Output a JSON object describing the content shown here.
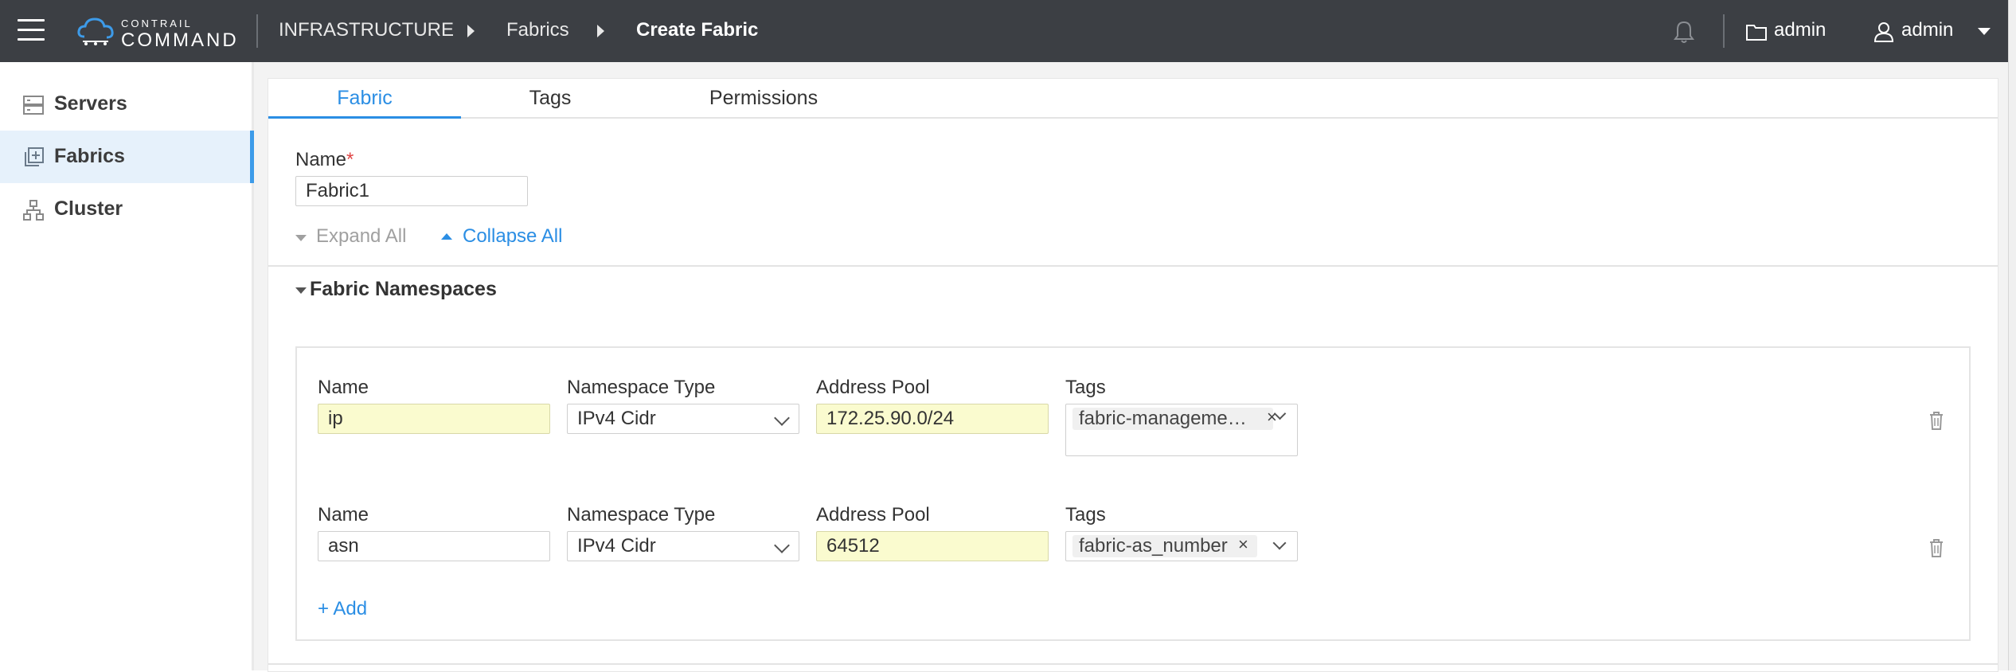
{
  "header": {
    "logo_small": "CONTRAIL",
    "logo_big": "COMMAND",
    "breadcrumb": [
      "INFRASTRUCTURE",
      "Fabrics",
      "Create Fabric"
    ],
    "project_label": "admin",
    "user_label": "admin",
    "icons": [
      "menu-icon",
      "cloud-logo-icon",
      "bell-icon",
      "folder-icon",
      "user-icon",
      "chevron-down-icon"
    ]
  },
  "sidebar": {
    "items": [
      {
        "label": "Servers",
        "icon": "server-icon",
        "active": false
      },
      {
        "label": "Fabrics",
        "icon": "fabric-icon",
        "active": true
      },
      {
        "label": "Cluster",
        "icon": "cluster-icon",
        "active": false
      }
    ]
  },
  "tabs": [
    {
      "label": "Fabric",
      "active": true
    },
    {
      "label": "Tags",
      "active": false
    },
    {
      "label": "Permissions",
      "active": false
    }
  ],
  "form": {
    "name_label": "Name",
    "required_mark": "*",
    "name_value": "Fabric1",
    "expand_all": "Expand All",
    "collapse_all": "Collapse All",
    "section_title": "Fabric Namespaces",
    "col_labels": {
      "name": "Name",
      "type": "Namespace Type",
      "pool": "Address Pool",
      "tags": "Tags"
    },
    "rows": [
      {
        "name": "ip",
        "type": "IPv4 Cidr",
        "pool": "172.25.90.0/24",
        "tag": "fabric-manageme…"
      },
      {
        "name": "asn",
        "type": "IPv4 Cidr",
        "pool": "64512",
        "tag": "fabric-as_number"
      }
    ],
    "add_label": "+ Add",
    "chip_close": "×"
  },
  "colors": {
    "topbar": "#3c3f44",
    "accent": "#2b8ee4",
    "highlight_input": "#fafbcf",
    "sidebar_active": "#e6f1fb"
  }
}
